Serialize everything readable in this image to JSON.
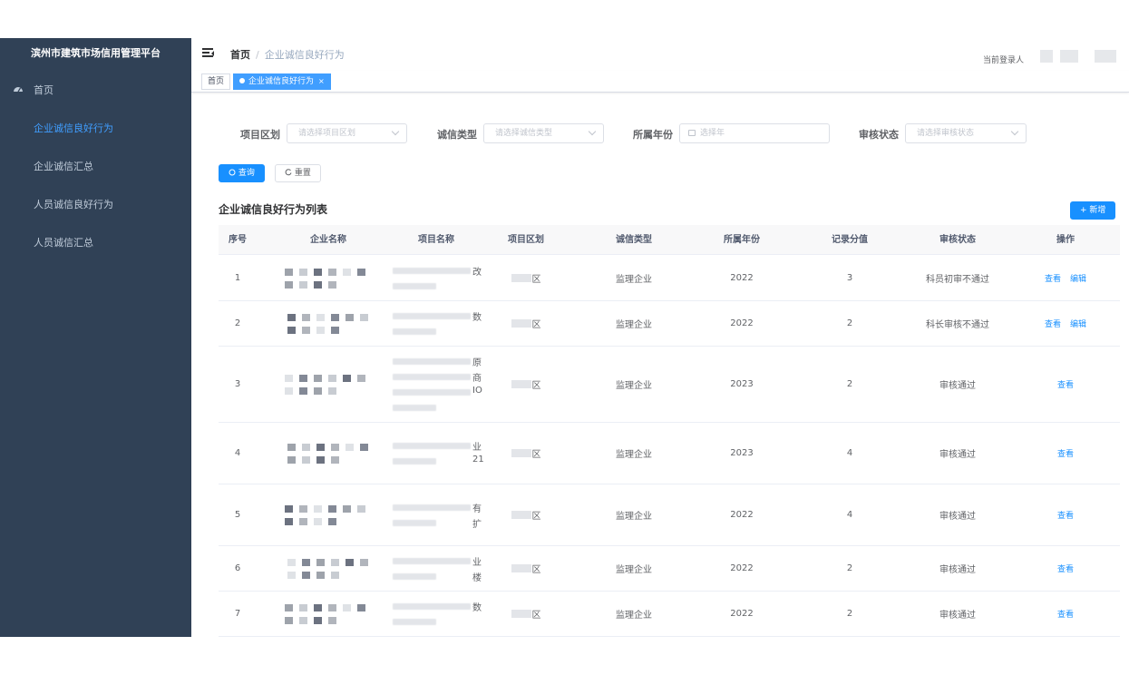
{
  "sidebar": {
    "brand": "滨州市建筑市场信用管理平台",
    "items": [
      {
        "label": "首页",
        "icon": "dashboard-icon"
      },
      {
        "label": "企业诚信良好行为",
        "active": true
      },
      {
        "label": "企业诚信汇总"
      },
      {
        "label": "人员诚信良好行为"
      },
      {
        "label": "人员诚信汇总"
      }
    ]
  },
  "navbar": {
    "breadcrumb_home": "首页",
    "breadcrumb_sep": "/",
    "breadcrumb_current": "企业诚信良好行为",
    "user_label": "当前登录人"
  },
  "tags": {
    "home": "首页",
    "current": "企业诚信良好行为",
    "close": "×"
  },
  "filters": {
    "region_label": "项目区划",
    "region_placeholder": "请选择项目区划",
    "type_label": "诚信类型",
    "type_placeholder": "请选择诚信类型",
    "year_label": "所属年份",
    "year_placeholder": "选择年",
    "status_label": "审核状态",
    "status_placeholder": "请选择审核状态"
  },
  "buttons": {
    "search": "查询",
    "reset": "重置",
    "add": "+ 新增"
  },
  "table": {
    "title": "企业诚信良好行为列表",
    "columns": [
      "序号",
      "企业名称",
      "项目名称",
      "项目区划",
      "诚信类型",
      "所属年份",
      "记录分值",
      "审核状态",
      "操作"
    ],
    "rows": [
      {
        "index": "1",
        "name_tail": "",
        "project_tail": [
          "改"
        ],
        "region": "区",
        "type": "监理企业",
        "year": "2022",
        "score": "3",
        "status": "科员初审不通过",
        "ops": [
          "查看",
          "编辑"
        ]
      },
      {
        "index": "2",
        "name_tail": "",
        "project_tail": [
          "数"
        ],
        "region": "区",
        "type": "监理企业",
        "year": "2022",
        "score": "2",
        "status": "科长审核不通过",
        "ops": [
          "查看",
          "编辑"
        ]
      },
      {
        "index": "3",
        "name_tail": "",
        "project_tail": [
          "原",
          "商",
          "IO"
        ],
        "region": "区",
        "type": "监理企业",
        "year": "2023",
        "score": "2",
        "status": "审核通过",
        "ops": [
          "查看"
        ]
      },
      {
        "index": "4",
        "name_tail": "",
        "project_tail": [
          "业",
          "21"
        ],
        "region": "区",
        "type": "监理企业",
        "year": "2023",
        "score": "4",
        "status": "审核通过",
        "ops": [
          "查看"
        ]
      },
      {
        "index": "5",
        "name_tail": "",
        "project_tail": [
          "有",
          "扩"
        ],
        "region": "区",
        "type": "监理企业",
        "year": "2022",
        "score": "4",
        "status": "审核通过",
        "ops": [
          "查看"
        ]
      },
      {
        "index": "6",
        "name_tail": "",
        "project_tail": [
          "业",
          "楼"
        ],
        "region": "区",
        "type": "监理企业",
        "year": "2022",
        "score": "2",
        "status": "审核通过",
        "ops": [
          "查看"
        ]
      },
      {
        "index": "7",
        "name_tail": "",
        "project_tail": [
          "数"
        ],
        "region": "区",
        "type": "监理企业",
        "year": "2022",
        "score": "2",
        "status": "审核通过",
        "ops": [
          "查看"
        ]
      }
    ]
  },
  "colors": {
    "sidebar_bg": "#304156",
    "accent": "#1890ff",
    "active_menu": "#409eff"
  }
}
